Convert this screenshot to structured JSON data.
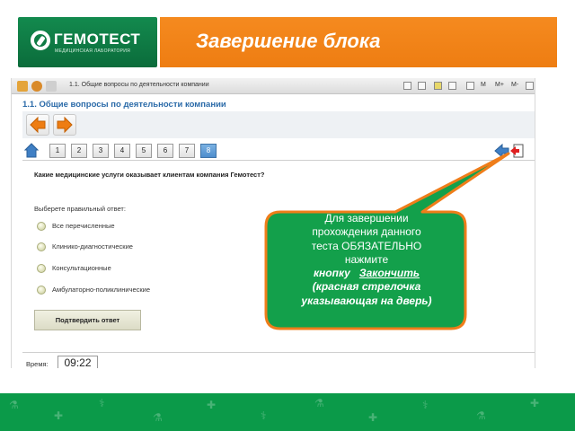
{
  "banner": {
    "logo_text": "ГЕМОТЕСТ",
    "logo_subtext": "МЕДИЦИНСКАЯ ЛАБОРАТОРИЯ",
    "title": "Завершение блока"
  },
  "window": {
    "title": "1.1. Общие вопросы по деятельности компании",
    "buttons": [
      "M",
      "M+",
      "M-"
    ]
  },
  "test": {
    "section_title": "1.1. Общие вопросы по деятельности компании",
    "tabs": [
      "1",
      "2",
      "3",
      "4",
      "5",
      "6",
      "7",
      "8"
    ],
    "active_tab": "8",
    "question": "Какие медицинские услуги оказывает клиентам компания Гемотест?",
    "prompt": "Выберете правильный ответ:",
    "options": [
      "Все перечисленные",
      "Клинико-диагностические",
      "Консультационные",
      "Амбулаторно-поликлинические"
    ],
    "submit_label": "Подтвердить ответ",
    "time_label": "Время:",
    "time_value": "09:22"
  },
  "callout": {
    "line1": "Для завершении",
    "line2": "прохождения данного",
    "line3": "теста ОБЯЗАТЕЛЬНО",
    "line4": "нажмите",
    "line5a": "кнопку",
    "line5b": "Закончить",
    "line6": "(красная стрелочка",
    "line7": "указывающая на дверь)"
  },
  "colors": {
    "green": "#0b9a49",
    "orange": "#f58a1f",
    "callout_fill": "#13a04b",
    "callout_border": "#ef7d1a",
    "tab_active": "#4e8dcc"
  },
  "icons": {
    "home": "home-icon",
    "back": "back-arrow-icon",
    "forward": "forward-arrow-icon",
    "exit": "exit-door-icon"
  }
}
